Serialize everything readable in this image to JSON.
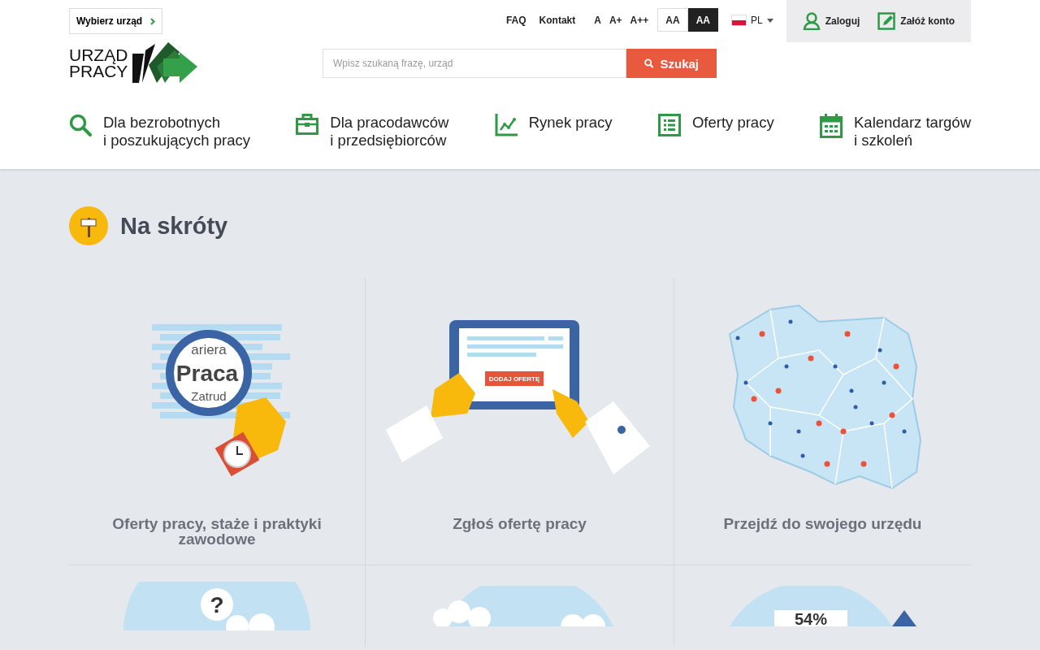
{
  "top_bar": {
    "office_button": "Wybierz urząd",
    "links": [
      "FAQ",
      "Kontakt"
    ],
    "font_sizes": [
      "A",
      "A+",
      "A++"
    ],
    "contrast": [
      {
        "label": "AA",
        "selected": false
      },
      {
        "label": "AA",
        "selected": true
      }
    ],
    "language": "PL",
    "account": [
      {
        "kind": "user",
        "label": "Zaloguj"
      },
      {
        "kind": "edit",
        "label": "Załóż konto"
      }
    ]
  },
  "logo": {
    "lines": [
      "URZĄD",
      "PRACY"
    ]
  },
  "search": {
    "placeholder": "Wpisz szukaną frazę, urząd",
    "button": "Szukaj"
  },
  "nav": [
    {
      "kind": "search",
      "label": "Dla bezrobotnych\ni poszukujących pracy"
    },
    {
      "kind": "briefcase",
      "label": "Dla pracodawców\ni przedsiębiorców"
    },
    {
      "kind": "chart",
      "label": "Rynek pracy"
    },
    {
      "kind": "list",
      "label": "Oferty pracy"
    },
    {
      "kind": "calendar",
      "label": "Kalendarz targów\ni szkoleń"
    }
  ],
  "section": {
    "title": "Na skróty"
  },
  "tiles": [
    {
      "kind": "magnifier",
      "label": "Oferty pracy, staże i praktyki zawodowe",
      "art_texts": [
        "ariera",
        "Praca",
        "Zatrud"
      ]
    },
    {
      "kind": "tablet",
      "label": "Zgłoś ofertę pracy",
      "art_texts": [
        "DODAJ OFERTĘ"
      ]
    },
    {
      "kind": "map",
      "label": "Przejdź do swojego urzędu"
    },
    {
      "kind": "question",
      "art_texts": [
        "?"
      ]
    },
    {
      "kind": "clouds"
    },
    {
      "kind": "stats",
      "art_texts": [
        "54%"
      ]
    }
  ]
}
